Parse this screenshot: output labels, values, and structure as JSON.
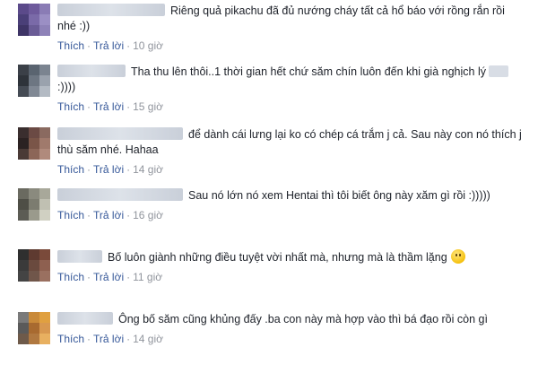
{
  "comments": [
    {
      "text_before": "Riêng quả pikachu đã đủ nướng cháy tất cả hổ báo với rồng rắn rồi nhé :))",
      "like": "Thích",
      "reply": "Trả lời",
      "sep": "·",
      "time": "10 giờ",
      "avatar": [
        "#5b4a8a",
        "#6e5a9c",
        "#8a7cb5",
        "#4a3f78",
        "#7a6aa8",
        "#9b8fc4",
        "#3e3466",
        "#6a5c96",
        "#8e82b8"
      ]
    },
    {
      "text_before": "Tha thu lên thôi..1 thời gian hết chứ săm chín luôn đến khi già nghịch lý",
      "text_after": ":))))",
      "like": "Thích",
      "reply": "Trả lời",
      "sep": "·",
      "time": "15 giờ",
      "avatar": [
        "#3b4048",
        "#5a6470",
        "#7b8490",
        "#2e333a",
        "#6d7682",
        "#9aa2ad",
        "#454b54",
        "#808894",
        "#b3bac3"
      ]
    },
    {
      "text_before": "để dành cái lưng lại ko có chép cá trắm j cả. Sau này con nó thích j thù săm nhé. Hahaa",
      "like": "Thích",
      "reply": "Trả lời",
      "sep": "·",
      "time": "14 giờ",
      "avatar": [
        "#3a2e2e",
        "#6b4a44",
        "#8a6a60",
        "#2b2222",
        "#7a5548",
        "#a07a6c",
        "#4a3a36",
        "#8c6658",
        "#b08a7c"
      ]
    },
    {
      "text_before": "Sau nó lớn nó xem Hentai thì tôi biết ông này xăm gì rồi :)))))",
      "like": "Thích",
      "reply": "Trả lời",
      "sep": "·",
      "time": "16 giờ",
      "avatar": [
        "#6a6a60",
        "#8a8a7e",
        "#a8a89a",
        "#4e4e46",
        "#7c7c70",
        "#c0c0b2",
        "#5c5c54",
        "#9a9a8c",
        "#d0d0c2"
      ]
    },
    {
      "text_before": "Bố luôn giành những điều tuyệt vời nhất mà, nhưng mà là thầm lặng",
      "like": "Thích",
      "reply": "Trả lời",
      "sep": "·",
      "time": "11 giờ",
      "avatar": [
        "#2f2f2f",
        "#5e3a30",
        "#7a4a3a",
        "#3a3a3a",
        "#6a4a3e",
        "#8e6050",
        "#444",
        "#70564a",
        "#9a7060"
      ]
    },
    {
      "text_before": "Ông bố săm cũng khủng đấy .ba con này mà hợp vào thì bá đạo rồi còn gì",
      "like": "Thích",
      "reply": "Trả lời",
      "sep": "·",
      "time": "14 giờ",
      "avatar": [
        "#7a7a7a",
        "#c98a3a",
        "#e0a040",
        "#5a5a5a",
        "#a86a30",
        "#d89850",
        "#6e5a4a",
        "#b07840",
        "#e8b060"
      ]
    }
  ]
}
